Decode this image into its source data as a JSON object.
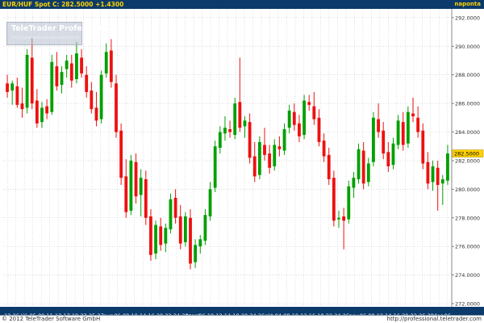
{
  "header": {
    "symbol": "EUR/HUF Spot",
    "quote": "C: 282.5000 +1.4300",
    "period": "naponta"
  },
  "watermark": {
    "title": "TeleTrader Professional",
    "url": "http://professional.teletrader.com"
  },
  "footer": {
    "copyright": "© 2012 TeleTrader Software GmbH",
    "url": "http://professional.teletrader.com"
  },
  "colors": {
    "background": "#0b3a6b",
    "up": "#00a000",
    "down": "#ee1010",
    "grid": "#c8c8c8",
    "label_text": "#ffd200",
    "last_price_box": "#ffd200"
  },
  "chart_data": {
    "type": "candlestick",
    "ylim": [
      272,
      292.5
    ],
    "y_ticks": [
      272,
      274,
      276,
      278,
      280,
      282,
      284,
      286,
      288,
      290,
      292
    ],
    "y_tick_labels": [
      "272.0000",
      "274.0000",
      "276.0000",
      "278.0000",
      "280.0000",
      "282.0000",
      "284.0000",
      "286.0000",
      "288.0000",
      "290.0000",
      "292.0000"
    ],
    "last_price_label": "282.5000",
    "last_price": 282.5,
    "x_tick_labels": [
      "12",
      "26",
      "júl.",
      "05",
      "09",
      "11",
      "13",
      "17",
      "19",
      "23",
      "25",
      "27",
      "aug.",
      "06",
      "08",
      "10",
      "14",
      "16",
      "20",
      "22",
      "24",
      "28",
      "szept.",
      "06",
      "10",
      "12",
      "14",
      "18",
      "20",
      "24",
      "26",
      "okt.",
      "04",
      "08",
      "10",
      "12",
      "16",
      "18",
      "22",
      "24",
      "26",
      "nov.",
      "06",
      "08",
      "12",
      "14",
      "16",
      "20",
      "22",
      "26",
      "28",
      "dec.",
      "06"
    ],
    "candles": [
      {
        "o": 287.4,
        "h": 288.0,
        "l": 286.4,
        "c": 286.8
      },
      {
        "o": 286.9,
        "h": 287.6,
        "l": 285.9,
        "c": 287.4
      },
      {
        "o": 287.2,
        "h": 287.8,
        "l": 285.7,
        "c": 285.9
      },
      {
        "o": 286.0,
        "h": 287.1,
        "l": 285.0,
        "c": 285.6
      },
      {
        "o": 285.7,
        "h": 289.8,
        "l": 285.3,
        "c": 289.4
      },
      {
        "o": 289.2,
        "h": 290.6,
        "l": 285.6,
        "c": 286.0
      },
      {
        "o": 286.2,
        "h": 287.0,
        "l": 284.3,
        "c": 284.6
      },
      {
        "o": 284.7,
        "h": 286.1,
        "l": 284.3,
        "c": 285.7
      },
      {
        "o": 285.8,
        "h": 286.3,
        "l": 284.9,
        "c": 285.3
      },
      {
        "o": 285.4,
        "h": 289.4,
        "l": 285.2,
        "c": 288.9
      },
      {
        "o": 288.6,
        "h": 289.6,
        "l": 286.9,
        "c": 287.2
      },
      {
        "o": 287.3,
        "h": 288.6,
        "l": 286.7,
        "c": 288.2
      },
      {
        "o": 288.4,
        "h": 289.4,
        "l": 287.8,
        "c": 289.0
      },
      {
        "o": 288.8,
        "h": 289.4,
        "l": 287.1,
        "c": 287.6
      },
      {
        "o": 287.7,
        "h": 290.3,
        "l": 287.4,
        "c": 289.5
      },
      {
        "o": 289.2,
        "h": 289.8,
        "l": 287.8,
        "c": 288.1
      },
      {
        "o": 288.0,
        "h": 288.6,
        "l": 286.4,
        "c": 286.8
      },
      {
        "o": 286.9,
        "h": 287.5,
        "l": 285.3,
        "c": 285.6
      },
      {
        "o": 285.7,
        "h": 286.8,
        "l": 284.4,
        "c": 284.8
      },
      {
        "o": 284.9,
        "h": 288.3,
        "l": 284.6,
        "c": 288.0
      },
      {
        "o": 288.1,
        "h": 290.2,
        "l": 287.8,
        "c": 289.6
      },
      {
        "o": 289.7,
        "h": 290.5,
        "l": 287.1,
        "c": 287.5
      },
      {
        "o": 287.4,
        "h": 288.0,
        "l": 283.6,
        "c": 284.0
      },
      {
        "o": 284.1,
        "h": 284.6,
        "l": 280.3,
        "c": 280.8
      },
      {
        "o": 280.9,
        "h": 282.1,
        "l": 278.0,
        "c": 278.4
      },
      {
        "o": 278.5,
        "h": 282.4,
        "l": 278.2,
        "c": 282.0
      },
      {
        "o": 281.9,
        "h": 282.5,
        "l": 279.0,
        "c": 279.5
      },
      {
        "o": 279.6,
        "h": 281.4,
        "l": 278.1,
        "c": 280.8
      },
      {
        "o": 280.7,
        "h": 281.3,
        "l": 277.5,
        "c": 278.0
      },
      {
        "o": 278.1,
        "h": 278.6,
        "l": 275.0,
        "c": 275.4
      },
      {
        "o": 275.5,
        "h": 277.8,
        "l": 275.1,
        "c": 277.5
      },
      {
        "o": 277.4,
        "h": 278.0,
        "l": 275.7,
        "c": 276.1
      },
      {
        "o": 276.2,
        "h": 277.6,
        "l": 275.6,
        "c": 277.3
      },
      {
        "o": 277.2,
        "h": 279.7,
        "l": 276.9,
        "c": 279.3
      },
      {
        "o": 279.4,
        "h": 280.0,
        "l": 277.6,
        "c": 278.0
      },
      {
        "o": 278.1,
        "h": 278.9,
        "l": 275.8,
        "c": 276.2
      },
      {
        "o": 276.3,
        "h": 278.4,
        "l": 276.0,
        "c": 278.1
      },
      {
        "o": 278.0,
        "h": 278.6,
        "l": 274.4,
        "c": 274.8
      },
      {
        "o": 274.9,
        "h": 276.5,
        "l": 274.5,
        "c": 276.1
      },
      {
        "o": 276.0,
        "h": 276.8,
        "l": 275.5,
        "c": 276.5
      },
      {
        "o": 276.4,
        "h": 278.6,
        "l": 276.1,
        "c": 278.2
      },
      {
        "o": 278.1,
        "h": 280.5,
        "l": 277.8,
        "c": 280.0
      },
      {
        "o": 280.1,
        "h": 283.4,
        "l": 279.8,
        "c": 283.0
      },
      {
        "o": 282.9,
        "h": 284.4,
        "l": 282.5,
        "c": 284.0
      },
      {
        "o": 283.9,
        "h": 285.1,
        "l": 283.4,
        "c": 284.3
      },
      {
        "o": 284.2,
        "h": 284.8,
        "l": 283.6,
        "c": 284.0
      },
      {
        "o": 283.8,
        "h": 286.4,
        "l": 283.5,
        "c": 286.0
      },
      {
        "o": 286.1,
        "h": 289.2,
        "l": 284.0,
        "c": 284.3
      },
      {
        "o": 284.4,
        "h": 285.1,
        "l": 283.6,
        "c": 284.8
      },
      {
        "o": 284.7,
        "h": 285.3,
        "l": 281.8,
        "c": 282.2
      },
      {
        "o": 282.3,
        "h": 283.3,
        "l": 280.5,
        "c": 280.9
      },
      {
        "o": 281.0,
        "h": 283.7,
        "l": 280.7,
        "c": 283.3
      },
      {
        "o": 283.1,
        "h": 284.3,
        "l": 282.0,
        "c": 282.4
      },
      {
        "o": 282.5,
        "h": 283.1,
        "l": 281.1,
        "c": 281.5
      },
      {
        "o": 281.6,
        "h": 283.5,
        "l": 281.3,
        "c": 283.1
      },
      {
        "o": 283.0,
        "h": 283.7,
        "l": 282.3,
        "c": 282.8
      },
      {
        "o": 282.7,
        "h": 284.6,
        "l": 282.4,
        "c": 284.2
      },
      {
        "o": 284.3,
        "h": 285.9,
        "l": 283.9,
        "c": 285.5
      },
      {
        "o": 285.4,
        "h": 286.0,
        "l": 284.1,
        "c": 284.5
      },
      {
        "o": 284.6,
        "h": 285.2,
        "l": 283.3,
        "c": 283.7
      },
      {
        "o": 283.8,
        "h": 286.6,
        "l": 283.5,
        "c": 286.2
      },
      {
        "o": 286.1,
        "h": 286.6,
        "l": 285.5,
        "c": 285.9
      },
      {
        "o": 285.8,
        "h": 286.8,
        "l": 284.5,
        "c": 284.9
      },
      {
        "o": 285.0,
        "h": 285.6,
        "l": 283.0,
        "c": 283.3
      },
      {
        "o": 283.4,
        "h": 283.9,
        "l": 281.9,
        "c": 282.3
      },
      {
        "o": 282.4,
        "h": 282.9,
        "l": 280.3,
        "c": 280.7
      },
      {
        "o": 280.8,
        "h": 281.3,
        "l": 277.4,
        "c": 277.8
      },
      {
        "o": 277.9,
        "h": 278.5,
        "l": 277.3,
        "c": 278.0
      },
      {
        "o": 278.1,
        "h": 278.7,
        "l": 275.8,
        "c": 277.8
      },
      {
        "o": 277.9,
        "h": 280.6,
        "l": 277.6,
        "c": 280.2
      },
      {
        "o": 280.1,
        "h": 281.2,
        "l": 279.4,
        "c": 280.8
      },
      {
        "o": 280.7,
        "h": 283.2,
        "l": 280.4,
        "c": 282.8
      },
      {
        "o": 282.7,
        "h": 283.3,
        "l": 280.0,
        "c": 280.4
      },
      {
        "o": 280.5,
        "h": 282.2,
        "l": 280.2,
        "c": 281.8
      },
      {
        "o": 281.9,
        "h": 285.4,
        "l": 281.6,
        "c": 285.0
      },
      {
        "o": 284.9,
        "h": 286.0,
        "l": 283.6,
        "c": 284.0
      },
      {
        "o": 284.1,
        "h": 284.7,
        "l": 282.1,
        "c": 282.5
      },
      {
        "o": 282.6,
        "h": 283.3,
        "l": 281.2,
        "c": 281.6
      },
      {
        "o": 281.7,
        "h": 283.6,
        "l": 281.4,
        "c": 283.2
      },
      {
        "o": 283.1,
        "h": 285.2,
        "l": 282.8,
        "c": 284.8
      },
      {
        "o": 284.7,
        "h": 285.4,
        "l": 282.7,
        "c": 283.1
      },
      {
        "o": 283.2,
        "h": 285.8,
        "l": 282.9,
        "c": 285.4
      },
      {
        "o": 285.3,
        "h": 286.4,
        "l": 284.7,
        "c": 285.1
      },
      {
        "o": 285.0,
        "h": 285.8,
        "l": 283.6,
        "c": 284.0
      },
      {
        "o": 284.1,
        "h": 284.6,
        "l": 281.4,
        "c": 281.8
      },
      {
        "o": 281.9,
        "h": 282.6,
        "l": 280.0,
        "c": 280.4
      },
      {
        "o": 280.5,
        "h": 282.0,
        "l": 279.9,
        "c": 281.6
      },
      {
        "o": 281.5,
        "h": 282.0,
        "l": 278.5,
        "c": 280.3
      },
      {
        "o": 280.4,
        "h": 281.0,
        "l": 278.9,
        "c": 280.7
      },
      {
        "o": 280.6,
        "h": 283.1,
        "l": 280.3,
        "c": 282.5
      }
    ]
  }
}
